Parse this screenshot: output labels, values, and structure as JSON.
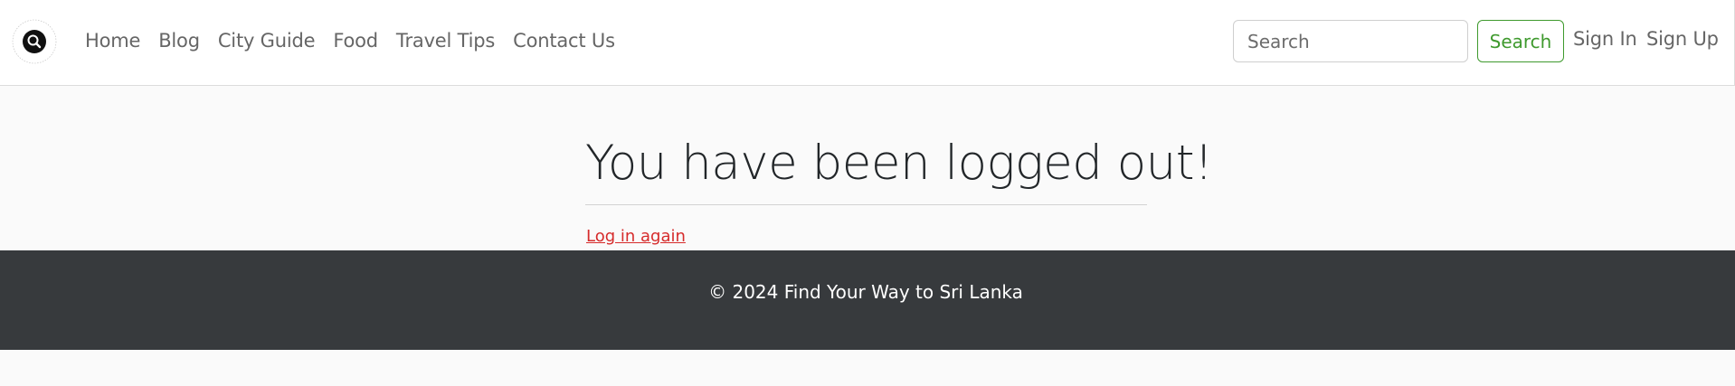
{
  "navbar": {
    "logo_icon": "magnifier-circle-logo",
    "links": [
      "Home",
      "Blog",
      "City Guide",
      "Food",
      "Travel Tips",
      "Contact Us"
    ],
    "search": {
      "placeholder": "Search",
      "value": ""
    },
    "search_button": "Search",
    "sign_in": "Sign In",
    "sign_up": "Sign Up"
  },
  "main": {
    "heading": "You have been logged out!",
    "relogin_link": "Log in again"
  },
  "footer": {
    "text": "© 2024 Find Your Way to Sri Lanka"
  },
  "colors": {
    "accent_green": "#3f9a2e",
    "link_red": "#d62b2b",
    "footer_bg": "#373a3d",
    "page_bg": "#fafafa"
  }
}
